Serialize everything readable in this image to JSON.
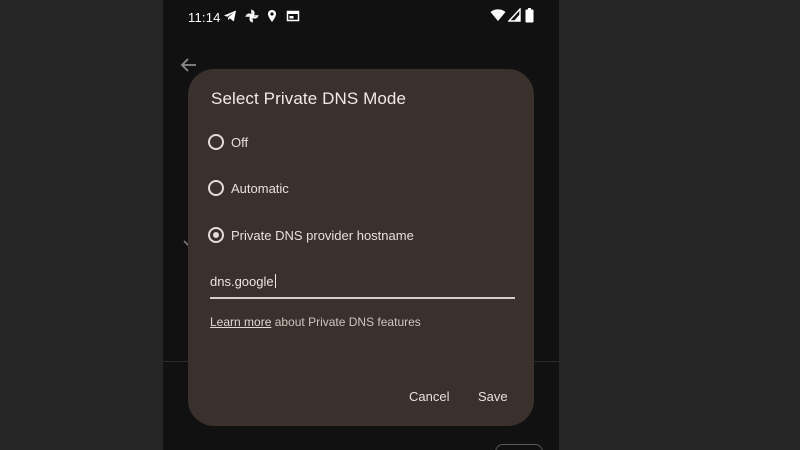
{
  "status_bar": {
    "time": "11:14",
    "left_icons": [
      "telegram-icon",
      "pinwheel-icon",
      "location-icon",
      "window-icon"
    ],
    "right_icons": [
      "wifi-icon",
      "cell-signal-icon",
      "battery-icon"
    ]
  },
  "dialog": {
    "title": "Select Private DNS Mode",
    "options": [
      {
        "label": "Off",
        "selected": false
      },
      {
        "label": "Automatic",
        "selected": false
      },
      {
        "label": "Private DNS provider hostname",
        "selected": true
      }
    ],
    "hostname_value": "dns.google",
    "learn_more_link": "Learn more",
    "learn_more_rest": " about Private DNS features",
    "cancel_label": "Cancel",
    "save_label": "Save"
  },
  "colors": {
    "dialog_bg": "#3a302c",
    "screen_bg": "#111111",
    "text": "#e8e0dc"
  }
}
